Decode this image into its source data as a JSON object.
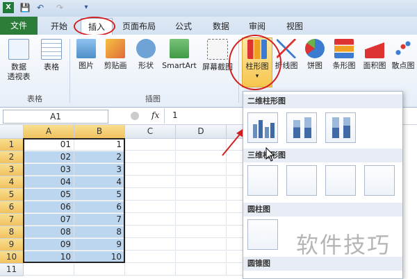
{
  "quick_access": {
    "icons": [
      "excel-icon",
      "save-icon",
      "undo-icon",
      "redo-icon",
      "customize-icon"
    ]
  },
  "tabs": [
    "文件",
    "开始",
    "插入",
    "页面布局",
    "公式",
    "数据",
    "审阅",
    "视图"
  ],
  "ribbon": {
    "buttons": [
      "数据\n透视表",
      "表格",
      "图片",
      "剪贴画",
      "形状",
      "SmartArt",
      "屏幕截图",
      "柱形图",
      "折线图",
      "饼图",
      "条形图",
      "面积图",
      "散点图"
    ],
    "groups": [
      "表格",
      "插图"
    ]
  },
  "formula_bar": {
    "name_box": "A1",
    "fx": "fx",
    "value": "1"
  },
  "columns": [
    "A",
    "B",
    "C",
    "D"
  ],
  "rows": [
    "1",
    "2",
    "3",
    "4",
    "5",
    "6",
    "7",
    "8",
    "9",
    "10",
    "11"
  ],
  "data_a": [
    "01",
    "02",
    "03",
    "04",
    "05",
    "06",
    "07",
    "08",
    "09",
    "10"
  ],
  "data_b": [
    "1",
    "2",
    "3",
    "4",
    "5",
    "6",
    "7",
    "8",
    "9",
    "10"
  ],
  "dropdown": {
    "sections": [
      "二维柱形图",
      "三维柱形图",
      "圆柱图",
      "圆锥图"
    ]
  },
  "watermark": "软件技巧",
  "colors": {
    "file_tab": "#2d7d3a",
    "selection": "#bcd6f0",
    "highlight": "#f1c15f",
    "annotation": "#d21f1f"
  }
}
